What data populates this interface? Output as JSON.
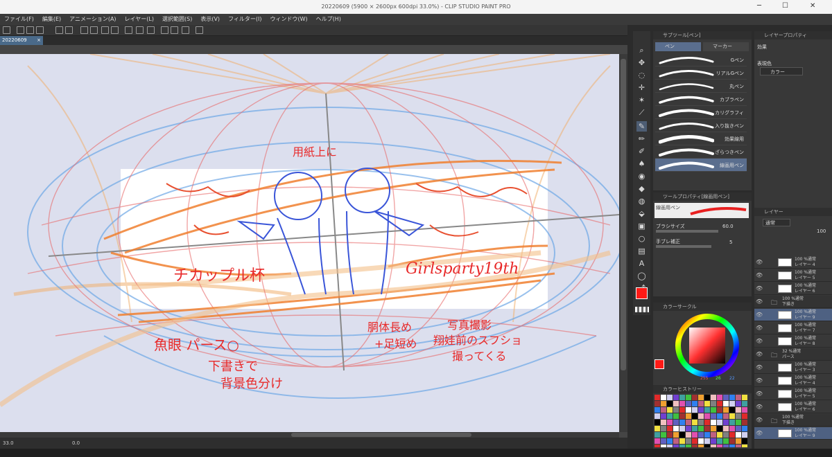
{
  "window": {
    "title": "20220609 (5900 × 2600px 600dpi 33.0%) - CLIP STUDIO PAINT PRO",
    "min_glyph": "─",
    "max_glyph": "☐",
    "close_glyph": "✕"
  },
  "menu": [
    "ファイル(F)",
    "編集(E)",
    "アニメーション(A)",
    "レイヤー(L)",
    "選択範囲(S)",
    "表示(V)",
    "フィルター(I)",
    "ウィンドウ(W)",
    "ヘルプ(H)"
  ],
  "document_tab": {
    "label": "20220609",
    "close": "×"
  },
  "canvas": {
    "notes": {
      "top": "用紙上に",
      "left_title": "チカップル杯",
      "right_title": "Girlsparty19th",
      "fisheye": "魚眼 パース○",
      "bg": "下書きで",
      "bg2": "背景色分け",
      "body": "胴体長め",
      "legs": "+足短め",
      "photo": "写真撮影",
      "photo2": "翔娃前のスフショ",
      "photo3": "撮ってくる"
    }
  },
  "status": {
    "zoom": "33.0",
    "angle": "0.0"
  },
  "subtool": {
    "header": "サブツール[ペン]",
    "tab_pen": "ペン",
    "tab_marker": "マーカー",
    "brushes": [
      "Gペン",
      "リアルGペン",
      "丸ペン",
      "カブラペン",
      "カリグラフィ",
      "入り抜きペン",
      "効果線用",
      "ざらつきペン",
      "線画用ペン"
    ],
    "selected_index": 8
  },
  "toolprop": {
    "header": "ツールプロパティ[線画用ペン]",
    "brush_name": "線画用ペン",
    "size_label": "ブラシサイズ",
    "size_value": "60.0",
    "stab_label": "手ブレ補正",
    "stab_value": "5"
  },
  "color": {
    "header": "カラーサークル",
    "r": "255",
    "g": "26",
    "b": "22",
    "main_color": "#ff1a16"
  },
  "history": {
    "header": "カラーヒストリー"
  },
  "layerprop": {
    "header": "レイヤープロパティ",
    "effect_label": "効果",
    "expr_label": "表現色",
    "expr_value": "カラー"
  },
  "layers": {
    "header": "レイヤー",
    "blend": "通常",
    "opacity": "100",
    "rows": [
      {
        "kind": "layer",
        "mode": "100 %通常",
        "name": "レイヤー 4"
      },
      {
        "kind": "layer",
        "mode": "100 %通常",
        "name": "レイヤー 5"
      },
      {
        "kind": "layer",
        "mode": "100 %通常",
        "name": "レイヤー 6"
      },
      {
        "kind": "folder",
        "mode": "100 %通常",
        "name": "下描き"
      },
      {
        "kind": "layer",
        "mode": "100 %通常",
        "name": "レイヤー 9",
        "sel": true
      },
      {
        "kind": "layer",
        "mode": "100 %通常",
        "name": "レイヤー 7"
      },
      {
        "kind": "layer",
        "mode": "100 %通常",
        "name": "レイヤー 8"
      },
      {
        "kind": "folder",
        "mode": "32 %通常",
        "name": "パース"
      },
      {
        "kind": "layer",
        "mode": "100 %通常",
        "name": "レイヤー 3"
      },
      {
        "kind": "layer",
        "mode": "100 %通常",
        "name": "レイヤー 4"
      },
      {
        "kind": "layer",
        "mode": "100 %通常",
        "name": "レイヤー 5"
      },
      {
        "kind": "layer",
        "mode": "100 %通常",
        "name": "レイヤー 6"
      },
      {
        "kind": "folder",
        "mode": "100 %通常",
        "name": "下描き"
      },
      {
        "kind": "layer",
        "mode": "100 %通常",
        "name": "レイヤー 9",
        "sel": true
      }
    ]
  }
}
